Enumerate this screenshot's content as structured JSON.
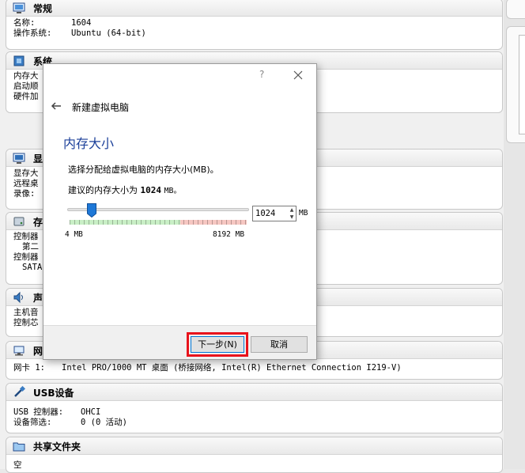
{
  "sections": {
    "general": {
      "title": "常规",
      "rows": [
        {
          "label": "名称:",
          "value": "1604"
        },
        {
          "label": "操作系统:",
          "value": "Ubuntu (64-bit)"
        }
      ]
    },
    "system": {
      "title": "系统",
      "rows": [
        {
          "label": "内存大"
        },
        {
          "label": "启动顺"
        },
        {
          "label": "硬件加"
        }
      ]
    },
    "display": {
      "title": "显",
      "rows": [
        {
          "label": "显存大"
        },
        {
          "label": "远程桌"
        },
        {
          "label": "录像:"
        }
      ]
    },
    "storage": {
      "title": "存",
      "rows": [
        {
          "label": "控制器"
        },
        {
          "label": "第二"
        },
        {
          "label": "控制器"
        },
        {
          "label": "SATA"
        }
      ]
    },
    "audio": {
      "title": "声",
      "rows": [
        {
          "label": "主机音"
        },
        {
          "label": "控制芯"
        }
      ]
    },
    "network": {
      "title": "网",
      "rows": [
        {
          "label": "网卡 1:",
          "value": "Intel PRO/1000 MT 桌面 (桥接网络, Intel(R) Ethernet Connection I219-V)"
        }
      ]
    },
    "usb": {
      "title": "USB设备",
      "rows": [
        {
          "label": "USB 控制器:",
          "value": "OHCI"
        },
        {
          "label": "设备筛选:",
          "value": "0 (0 活动)"
        }
      ]
    },
    "shared": {
      "title": "共享文件夹",
      "rows": [
        {
          "label": "空"
        }
      ]
    }
  },
  "dialog": {
    "help_glyph": "?",
    "title": "新建虚拟电脑",
    "heading": "内存大小",
    "description": "选择分配给虚拟电脑的内存大小(MB)。",
    "recommend_prefix": "建议的内存大小为",
    "recommend_value": "1024",
    "recommend_unit": "MB。",
    "slider": {
      "min_label": "4 MB",
      "max_label": "8192 MB",
      "min": 4,
      "max": 8192,
      "value": 1024,
      "green_until": 5120
    },
    "memory_value": "1024",
    "memory_unit": "MB",
    "next_label": "下一步(N)",
    "cancel_label": "取消"
  },
  "colors": {
    "heading": "#1b3f99",
    "highlight": "#e8131c",
    "slider_green": "#c9efc6",
    "slider_red": "#f6c7c2",
    "thumb": "#1e78d7"
  }
}
